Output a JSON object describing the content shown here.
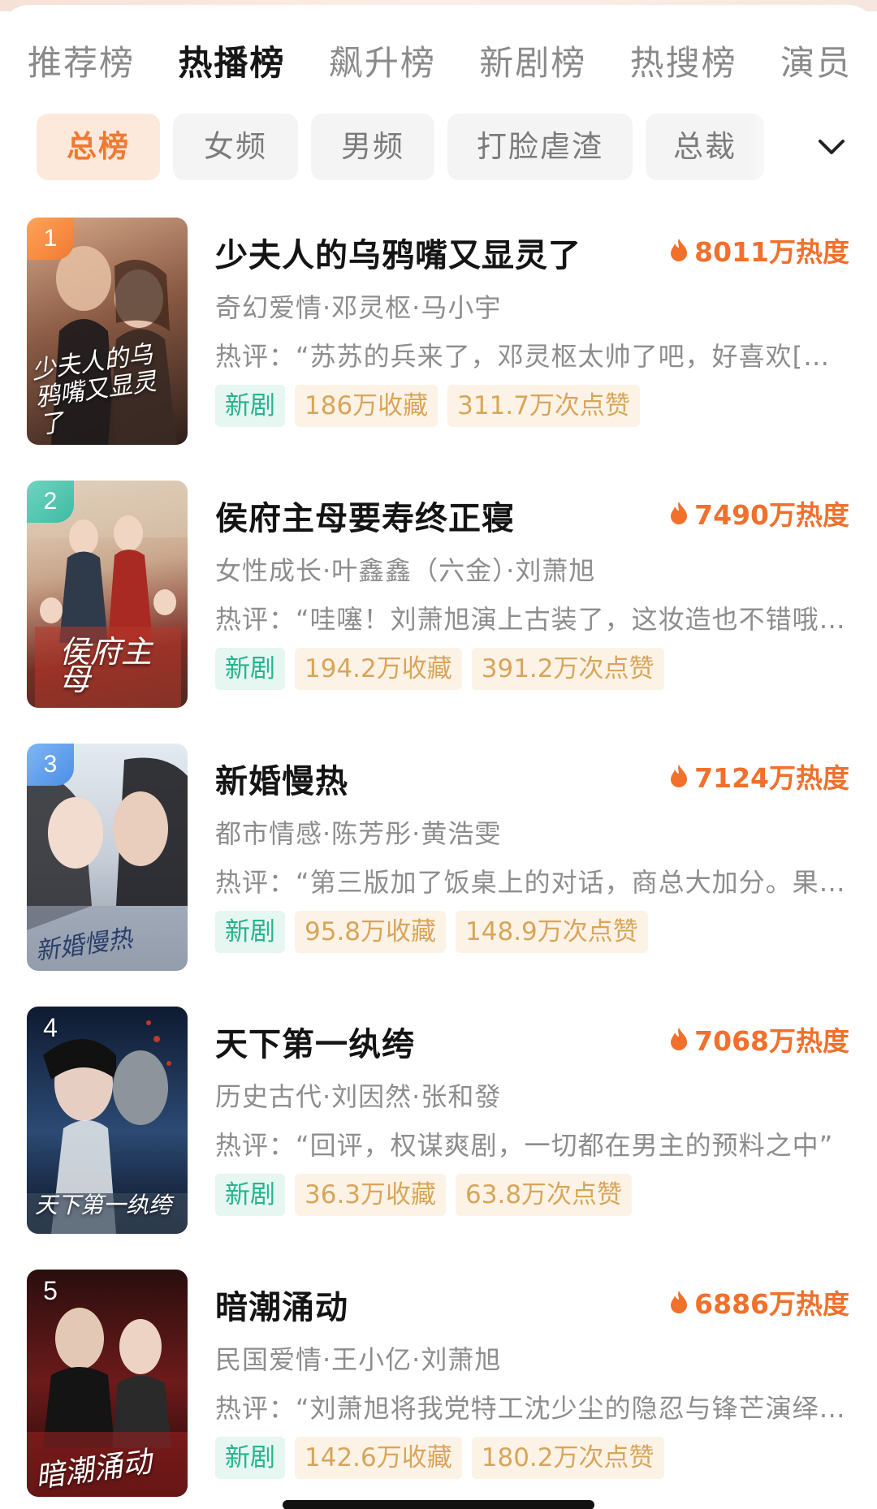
{
  "main_tabs": [
    "推荐榜",
    "热播榜",
    "飙升榜",
    "新剧榜",
    "热搜榜",
    "演员"
  ],
  "sub_tabs": [
    "总榜",
    "女频",
    "男频",
    "打脸虐渣",
    "总裁"
  ],
  "items": [
    {
      "rank": "1",
      "title": "少夫人的乌鸦嘴又显灵了",
      "heat": "8011万热度",
      "meta": "奇幻爱情·邓灵枢·马小宇",
      "review": "热评：“苏苏的兵来了，邓灵枢太帅了吧，好喜欢[…",
      "tag_new": "新剧",
      "favorites": "186万收藏",
      "likes": "311.7万次点赞",
      "poster_text": "少夫人的乌鸦嘴又显灵了",
      "poster_colors": [
        "#c89a7a",
        "#6b4a3a",
        "#2e1f1a"
      ]
    },
    {
      "rank": "2",
      "title": "侯府主母要寿终正寝",
      "heat": "7490万热度",
      "meta": "女性成长·叶鑫鑫（六金）·刘萧旭",
      "review": "热评：“哇噻！刘萧旭演上古装了，这妆造也不错哦…",
      "tag_new": "新剧",
      "favorites": "194.2万收藏",
      "likes": "391.2万次点赞",
      "poster_text": "侯府主母",
      "poster_colors": [
        "#e9d8c4",
        "#b23b2e",
        "#6a3a2a"
      ]
    },
    {
      "rank": "3",
      "title": "新婚慢热",
      "heat": "7124万热度",
      "meta": "都市情感·陈芳彤·黄浩雯",
      "review": "热评：“第三版加了饭桌上的对话，商总大加分。果…",
      "tag_new": "新剧",
      "favorites": "95.8万收藏",
      "likes": "148.9万次点赞",
      "poster_text": "新婚慢热",
      "poster_colors": [
        "#dfe6ef",
        "#b9c3cf",
        "#4b5565"
      ]
    },
    {
      "rank": "4",
      "title": "天下第一纨绔",
      "heat": "7068万热度",
      "meta": "历史古代·刘因然·张和發",
      "review": "热评：“回评，权谋爽剧，一切都在男主的预料之中”",
      "tag_new": "新剧",
      "favorites": "36.3万收藏",
      "likes": "63.8万次点赞",
      "poster_text": "天下第一纨绔",
      "poster_colors": [
        "#1c2a44",
        "#3b5f8c",
        "#0c1424"
      ]
    },
    {
      "rank": "5",
      "title": "暗潮涌动",
      "heat": "6886万热度",
      "meta": "民国爱情·王小亿·刘萧旭",
      "review": "热评：“刘萧旭将我党特工沈少尘的隐忍与锋芒演绎…",
      "tag_new": "新剧",
      "favorites": "142.6万收藏",
      "likes": "180.2万次点赞",
      "poster_text": "暗潮涌动",
      "poster_colors": [
        "#3a1414",
        "#7a1d1d",
        "#120808"
      ]
    }
  ]
}
